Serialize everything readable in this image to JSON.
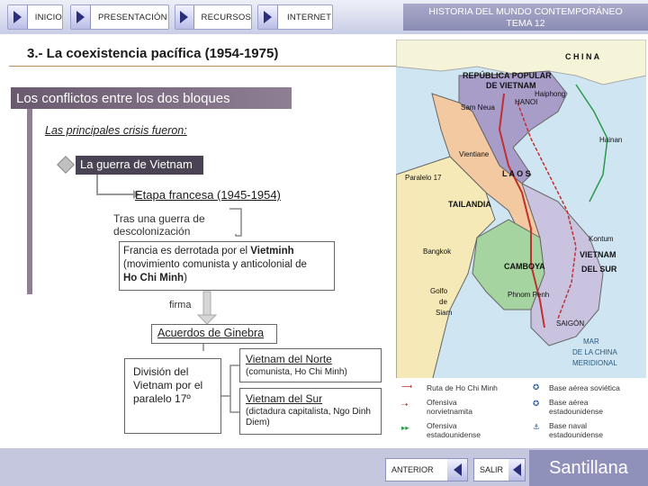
{
  "nav": {
    "inicio": "INICIO",
    "presentacion": "PRESENTACIÓN",
    "recursos": "RECURSOS",
    "internet": "INTERNET"
  },
  "header": {
    "title_line1": "HISTORIA DEL MUNDO CONTEMPORÁNEO",
    "title_line2": "TEMA 12"
  },
  "section": {
    "title": "3.- La coexistencia pacífica (1954-1975)",
    "banner": "Los conflictos entre los dos bloques",
    "intro": "Las principales crisis fueron:"
  },
  "content": {
    "topic": "La guerra de Vietnam",
    "stage": "Etapa francesa (1945-1954)",
    "war_line1": "Tras una guerra de",
    "war_line2": "descolonización",
    "result_line1": "Francia es derrotada por el ",
    "result_bold1": "Vietminh",
    "result_line2": "(movimiento comunista y anticolonial de",
    "result_bold2": "Ho Chi Minh",
    "result_end": ")",
    "firma": "firma",
    "acuerdos": "Acuerdos de Ginebra",
    "division_line1": "División del",
    "division_line2": "Vietnam por el",
    "division_line3": "paralelo 17º",
    "north_title": "Vietnam del Norte",
    "north_sub": "(comunista, Ho Chi Minh)",
    "south_title": "Vietnam del Sur",
    "south_sub": "(dictadura capitalista, Ngo Dinh Diem)"
  },
  "map": {
    "china": "C H I N A",
    "rpv": "REPÚBLICA POPULAR",
    "rpv2": "DE VIETNAM",
    "haiphong": "Haiphong",
    "hanoi": "HANOI",
    "samneua": "Sam Neua",
    "hainan": "Hainan",
    "vientiane": "Vientiane",
    "paralelo": "Paralelo 17",
    "laos": "L A O S",
    "tailandia": "TAILANDIA",
    "bangkok": "Bangkok",
    "camboya": "CAMBOYA",
    "vietnam_sur": "VIETNAM",
    "vietnam_sur2": "DEL SUR",
    "golfo": "Golfo",
    "de": "de",
    "siam": "Siam",
    "phnompenh": "Phnom Penh",
    "saigon": "SAIGÓN",
    "mar1": "MAR",
    "mar2": "DE LA CHINA",
    "mar3": "MERIDIONAL",
    "kontum": "Kontum",
    "colors": {
      "north": "#a89cc8",
      "laos": "#f2c9a0",
      "thai": "#f5e9b8",
      "cambodia": "#a6d4a0",
      "south": "#c9c3e0",
      "sea": "#cfe6f2",
      "china": "#f6f4d8"
    }
  },
  "legend": {
    "ruta": "Ruta de Ho Chi Minh",
    "ofensiva_n1": "Ofensiva",
    "ofensiva_n2": "norvietnamita",
    "ofensiva_e1": "Ofensiva",
    "ofensiva_e2": "estadounidense",
    "base_sov": "Base aérea soviética",
    "base_aerea1": "Base aérea",
    "base_aerea2": "estadounidense",
    "base_naval1": "Base naval",
    "base_naval2": "estadounidense"
  },
  "footer": {
    "anterior": "ANTERIOR",
    "salir": "SALIR",
    "brand": "Santillana"
  }
}
